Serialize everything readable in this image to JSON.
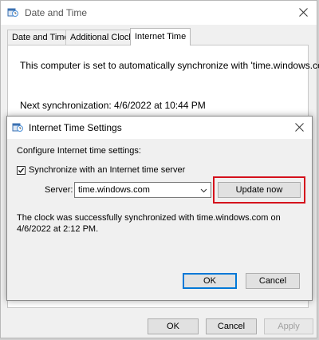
{
  "window": {
    "title": "Date and Time",
    "tabs": [
      {
        "label": "Date and Time"
      },
      {
        "label": "Additional Clocks"
      },
      {
        "label": "Internet Time"
      }
    ],
    "sync_message": "This computer is set to automatically synchronize with 'time.windows.com'.",
    "next_sync": "Next synchronization: 4/6/2022 at 10:44 PM",
    "buttons": {
      "ok": "OK",
      "cancel": "Cancel",
      "apply": "Apply"
    }
  },
  "dialog": {
    "title": "Internet Time Settings",
    "configure_label": "Configure Internet time settings:",
    "sync_checkbox_label": "Synchronize with an Internet time server",
    "sync_checked": true,
    "server_label": "Server:",
    "server_value": "time.windows.com",
    "update_button": "Update now",
    "status_line1": "The clock was successfully synchronized with time.windows.com on",
    "status_line2": "4/6/2022 at 2:12 PM.",
    "ok": "OK",
    "cancel": "Cancel"
  },
  "icons": {
    "window_icon": "date-time-icon",
    "close": "close-icon",
    "dropdown": "chevron-down-icon",
    "check": "check-icon"
  },
  "colors": {
    "highlight": "#d4101c",
    "focus": "#0078d7"
  }
}
